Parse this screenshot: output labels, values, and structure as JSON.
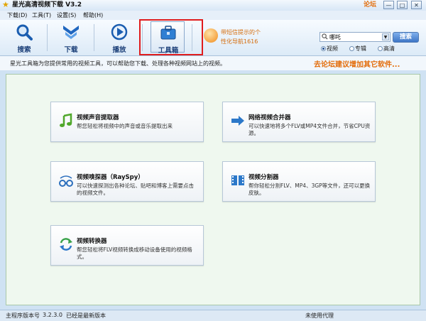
{
  "window": {
    "title": "星光高清视频下载 V3.2",
    "forum": "论坛"
  },
  "menu": [
    "下载(D)",
    "工具(T)",
    "设置(S)",
    "帮助(H)"
  ],
  "toolbar": {
    "search": "搜索",
    "download": "下载",
    "play": "播放",
    "toolbox": "工具箱",
    "sms_line1": "带短信提示的个",
    "sms_line2": "性化导航1616"
  },
  "search": {
    "value": "哪吒",
    "button": "搜索",
    "options": [
      "视频",
      "专辑",
      "高清"
    ]
  },
  "info": {
    "text": "星光工具箱为您提供常用的视频工具，可以帮助您下载、处理各种视频网站上的视频。",
    "suggest": "去论坛建议增加其它软件..."
  },
  "tools": [
    {
      "title": "视频声音提取器",
      "desc": "帮您轻松将视频中的声音或音乐提取出来",
      "icon": "music-note-icon"
    },
    {
      "title": "网络视频合并器",
      "desc": "可以快速地将多个FLV或MP4文件合并，节省CPU资源。",
      "icon": "merge-arrow-icon"
    },
    {
      "title": "视频嗅探器（RaySpy）",
      "desc": "可以快速探测出各种论坛、贴吧和博客上需要点击的视频文件。",
      "icon": "sniffer-icon"
    },
    {
      "title": "视频分割器",
      "desc": "帮你轻松分割FLV、MP4、3GP等文件，还可以更换皮肤。",
      "icon": "film-split-icon"
    },
    {
      "title": "视频转换器",
      "desc": "帮您轻松将FLV视频转换成移动设备使用的视频格式。",
      "icon": "convert-icon"
    }
  ],
  "status": {
    "version_label": "主程序版本号",
    "version": "3.2.3.0",
    "latest": "已经是最新版本",
    "proxy": "未使用代理"
  },
  "colors": {
    "accent": "#1b3f78",
    "orange": "#e36c09",
    "highlight": "#e01c1c"
  }
}
